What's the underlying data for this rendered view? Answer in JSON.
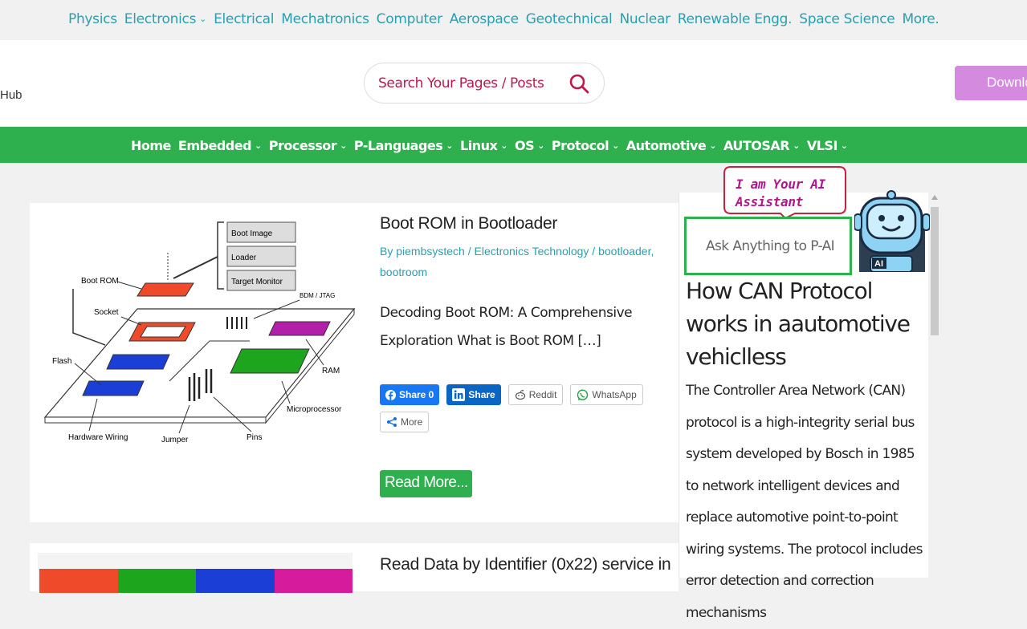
{
  "top_nav": {
    "items": [
      "Physics",
      "Electronics",
      "Electrical",
      "Mechatronics",
      "Computer",
      "Aerospace",
      "Geotechnical",
      "Nuclear",
      "Renewable Engg.",
      "Space Science",
      "More."
    ]
  },
  "header": {
    "brand_fragment": "Hub",
    "search_placeholder": "Search Your Pages / Posts",
    "download_label": "Downlo"
  },
  "main_nav": {
    "items": [
      "Home",
      "Embedded",
      "Processor",
      "P-Languages",
      "Linux",
      "OS",
      "Protocol",
      "Automotive",
      "AUTOSAR",
      "VLSI"
    ]
  },
  "post1": {
    "title": "Boot ROM in Bootloader",
    "meta": "By piembsystech / Electronics Technology / bootloader, bootroom",
    "excerpt": "Decoding Boot ROM: A Comprehensive Exploration What is Boot ROM […]",
    "diagram_labels": {
      "boot_image": "Boot Image",
      "loader": "Loader",
      "target_monitor": "Target Monitor",
      "boot_rom": "Boot ROM",
      "socket": "Socket",
      "bdm": "BDM / JTAG",
      "flash": "Flash",
      "ram": "RAM",
      "microprocessor": "Microprocessor",
      "hardware_wiring": "Hardware Wiring",
      "jumper": "Jumper",
      "pins": "Pins"
    },
    "share": {
      "facebook": "Share 0",
      "linkedin": "Share",
      "reddit": "Reddit",
      "whatsapp": "WhatsApp",
      "more": "More"
    },
    "read_more": "Read More..."
  },
  "post2": {
    "title": "Read Data by Identifier (0x22) service in"
  },
  "ai_widget": {
    "bubble": "I am Your AI Assistant",
    "bubble_line1": "I am Your AI",
    "bubble_line2": "Assistant",
    "ask_label": "Ask Anything to P-AI",
    "robot_badge": "AI"
  },
  "sidebar_article": {
    "title": "How CAN Protocol works in aautomotive vehiclless",
    "body": "The Controller Area Network (CAN) protocol is a high-integrity serial bus system developed by Bosch in 1985 to network intelligent devices and replace automotive point-to-point wiring systems. The protocol includes error detection and correction mechanisms"
  },
  "colors": {
    "accent_teal": "#2a9fb0",
    "nav_green": "#2eb04f",
    "search_text": "#c0184a",
    "download_bg": "#d48bdf",
    "ai_bubble": "#b0178a"
  }
}
